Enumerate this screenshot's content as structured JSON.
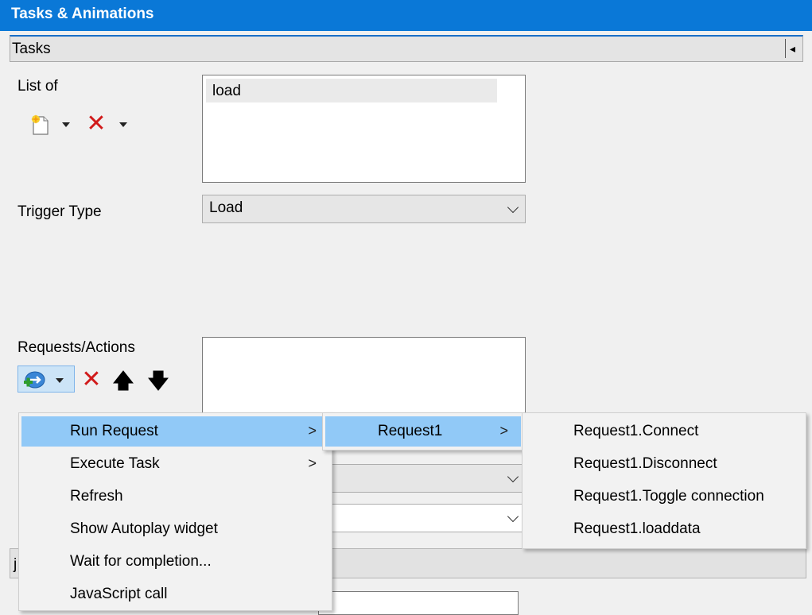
{
  "window": {
    "title": "Tasks & Animations"
  },
  "tasks_section": {
    "header": "Tasks",
    "collapse_glyph": "◂"
  },
  "list_of": {
    "label": "List of",
    "items": [
      "load"
    ],
    "new_icon": "new-document-icon",
    "delete_icon": "delete-x-icon"
  },
  "trigger_type": {
    "label": "Trigger Type",
    "value": "Load"
  },
  "requests_actions": {
    "label": "Requests/Actions",
    "add_icon": "add-action-icon",
    "delete_icon": "delete-x-icon",
    "up_icon": "arrow-up-icon",
    "down_icon": "arrow-down-icon"
  },
  "background_fields": {
    "partial_label_char": "j"
  },
  "context_menu": {
    "items": [
      {
        "label": "Run Request",
        "has_submenu": true,
        "highlighted": true
      },
      {
        "label": "Execute Task",
        "has_submenu": true,
        "highlighted": false
      },
      {
        "label": "Refresh",
        "has_submenu": false,
        "highlighted": false
      },
      {
        "label": "Show Autoplay widget",
        "has_submenu": false,
        "highlighted": false
      },
      {
        "label": "Wait for completion...",
        "has_submenu": false,
        "highlighted": false
      },
      {
        "label": "JavaScript call",
        "has_submenu": false,
        "highlighted": false
      }
    ],
    "submenu_glyph": ">"
  },
  "request_submenu": {
    "items": [
      {
        "label": "Request1",
        "has_submenu": true,
        "highlighted": true
      }
    ]
  },
  "action_submenu": {
    "items": [
      {
        "label": "Request1.Connect",
        "highlighted": true
      },
      {
        "label": "Request1.Disconnect",
        "highlighted": false
      },
      {
        "label": "Request1.Toggle connection",
        "highlighted": false
      },
      {
        "label": "Request1.loaddata",
        "highlighted": false
      }
    ]
  },
  "colors": {
    "titlebar": "#0a78d7",
    "highlight": "#91c9f7",
    "panel": "#f0f0f0",
    "delete_red": "#d11a1a"
  }
}
